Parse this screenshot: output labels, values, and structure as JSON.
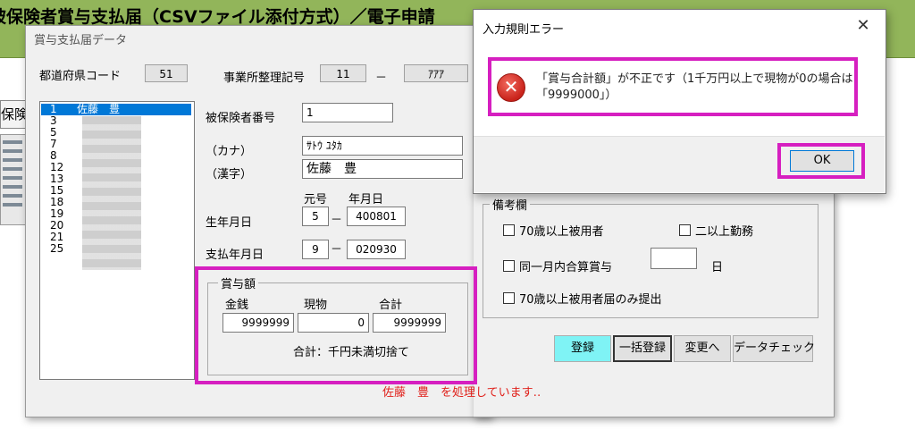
{
  "app": {
    "title": "被保険者賞与支払届（CSVファイル添付方式）／電子申請",
    "side_tab_label": "保険"
  },
  "dialog": {
    "title": "賞与支払届データ",
    "pref_code_label": "都道府県コード",
    "pref_code_value": "51",
    "office_label": "事業所整理記号",
    "office_code1": "11",
    "office_sep": "－",
    "office_code2": "ｱｱｱ",
    "insured_no_label": "被保険者番号",
    "insured_no_value": "1",
    "kana_label": "（カナ）",
    "kana_value": "ｻﾄｳ ﾕﾀｶ",
    "kanji_label": "（漢字）",
    "kanji_value": "佐藤　豊",
    "era_label": "元号",
    "ymd_label": "年月日",
    "birth_label": "生年月日",
    "birth_era": "5",
    "birth_date": "400801",
    "pay_label": "支払年月日",
    "pay_era": "9",
    "pay_date": "020930",
    "dash": "－",
    "list": [
      {
        "num": "1",
        "name": "佐藤　豊"
      },
      {
        "num": "3",
        "name": ""
      },
      {
        "num": "5",
        "name": ""
      },
      {
        "num": "7",
        "name": ""
      },
      {
        "num": "8",
        "name": ""
      },
      {
        "num": "12",
        "name": ""
      },
      {
        "num": "13",
        "name": ""
      },
      {
        "num": "15",
        "name": ""
      },
      {
        "num": "18",
        "name": ""
      },
      {
        "num": "19",
        "name": ""
      },
      {
        "num": "20",
        "name": ""
      },
      {
        "num": "21",
        "name": ""
      },
      {
        "num": "25",
        "name": ""
      }
    ],
    "bonus": {
      "title": "賞与額",
      "cash_label": "金銭",
      "kind_label": "現物",
      "total_label": "合計",
      "cash_value": "9999999",
      "kind_value": "0",
      "total_value": "9999999",
      "note": "合計：千円未満切捨て"
    },
    "remarks": {
      "title": "備考欄",
      "over70": "70歳以上被用者",
      "multi": "二以上勤務",
      "same_month": "同一月内合算賞与",
      "day_unit": "日",
      "over70_only": "70歳以上被用者届のみ提出"
    },
    "buttons": {
      "register": "登録",
      "bulk_register": "一括登録",
      "change": "変更へ",
      "data_check": "データチェック"
    },
    "status": "佐藤　豊　を処理しています‥"
  },
  "error_dialog": {
    "title": "入力規則エラー",
    "close": "✕",
    "message": "「賞与合計額」が不正です（1千万円以上で現物が0の場合は「9999000」）",
    "ok": "OK"
  },
  "colors": {
    "highlight": "#d61fc0",
    "app_bar": "#92b55a",
    "selection": "#0078d7",
    "register_button": "#7ff3f5",
    "status_text": "#e0201a"
  }
}
